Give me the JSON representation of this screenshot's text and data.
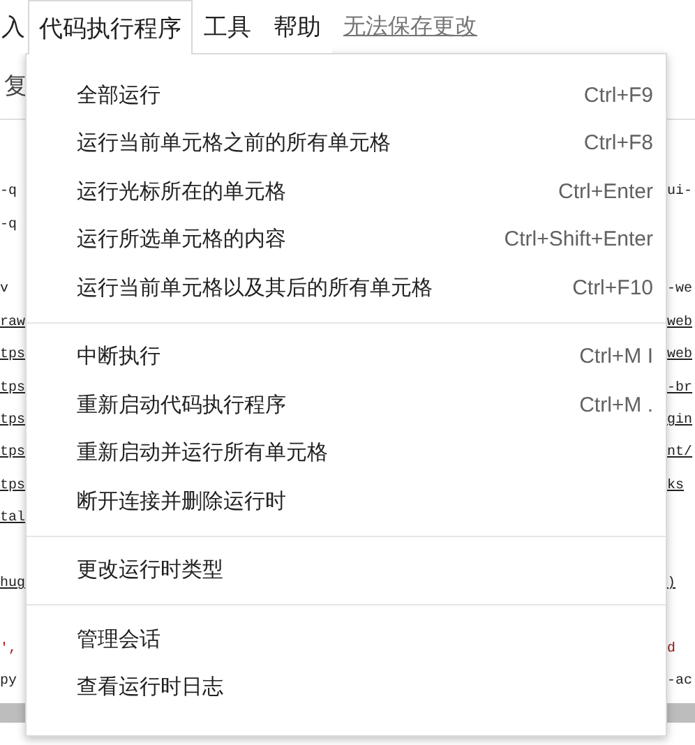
{
  "menubar": [
    {
      "label": "入",
      "selected": false
    },
    {
      "label": "代码执行程序",
      "selected": true
    },
    {
      "label": "工具",
      "selected": false
    },
    {
      "label": "帮助",
      "selected": false
    }
  ],
  "save_status": "无法保存更改",
  "toolbar": {
    "label": "复"
  },
  "code_lines": [
    {
      "kind": "plain",
      "left": "-q",
      "right": "ui-"
    },
    {
      "kind": "plain",
      "left": "-q"
    },
    {
      "kind": "blank"
    },
    {
      "kind": "plain",
      "left": "v",
      "right": "-we"
    },
    {
      "kind": "link",
      "left": "raw",
      "right": "web"
    },
    {
      "kind": "link",
      "left": "tps",
      "right": "web"
    },
    {
      "kind": "link",
      "left": "tps",
      "right": "-br"
    },
    {
      "kind": "link",
      "left": "tps",
      "right": "gin"
    },
    {
      "kind": "link",
      "left": "tps",
      "right": "nt/"
    },
    {
      "kind": "link",
      "left": "tps",
      "right": "ks"
    },
    {
      "kind": "link",
      "left": "tal"
    },
    {
      "kind": "blank"
    },
    {
      "kind": "link",
      "left": "hug",
      "right": ")"
    },
    {
      "kind": "blank"
    },
    {
      "kind": "string",
      "left": "',",
      "right": "d"
    },
    {
      "kind": "plain",
      "left": "py",
      "right": "-ac"
    }
  ],
  "menu": {
    "groups": [
      [
        {
          "label": "全部运行",
          "shortcut": "Ctrl+F9"
        },
        {
          "label": "运行当前单元格之前的所有单元格",
          "shortcut": "Ctrl+F8"
        },
        {
          "label": "运行光标所在的单元格",
          "shortcut": "Ctrl+Enter"
        },
        {
          "label": "运行所选单元格的内容",
          "shortcut": "Ctrl+Shift+Enter"
        },
        {
          "label": "运行当前单元格以及其后的所有单元格",
          "shortcut": "Ctrl+F10"
        }
      ],
      [
        {
          "label": "中断执行",
          "shortcut": "Ctrl+M I"
        },
        {
          "label": "重新启动代码执行程序",
          "shortcut": "Ctrl+M ."
        },
        {
          "label": "重新启动并运行所有单元格"
        },
        {
          "label": "断开连接并删除运行时"
        }
      ],
      [
        {
          "label": "更改运行时类型"
        }
      ],
      [
        {
          "label": "管理会话"
        },
        {
          "label": "查看运行时日志"
        }
      ]
    ]
  }
}
